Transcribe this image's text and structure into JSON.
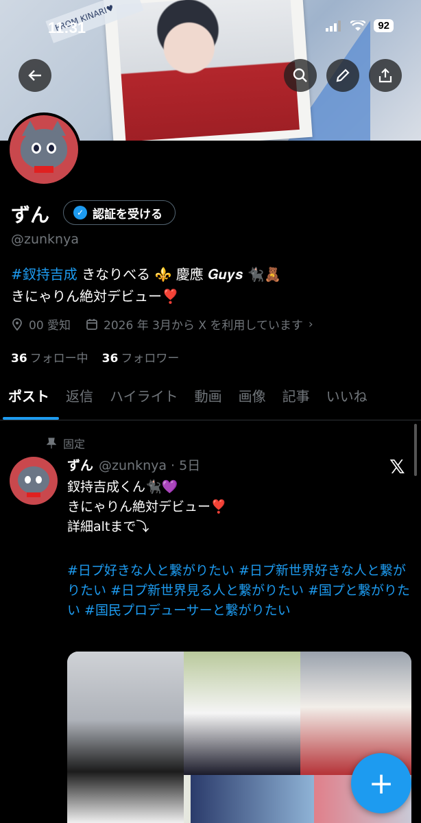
{
  "status_bar": {
    "time": "11:31",
    "battery": "92"
  },
  "banner": {
    "tape_text": "FROM KINARI♥"
  },
  "profile": {
    "name": "ずん",
    "verify_label": "認証を受ける",
    "handle": "@zunknya",
    "bio_hashtag": "#釵持吉成",
    "bio_line1_rest": " きなりべる ⚜️ 慶應 𝑮𝒖𝒚𝒔 🐈‍⬛🧸",
    "bio_line2": "きにゃりん絶対デビュー❣️",
    "location": "00 愛知",
    "joined": "2026 年 3月から X を利用しています",
    "following_count": "36",
    "following_label": "フォロー中",
    "followers_count": "36",
    "followers_label": "フォロワー"
  },
  "tabs": [
    "ポスト",
    "返信",
    "ハイライト",
    "動画",
    "画像",
    "記事",
    "いいね"
  ],
  "post": {
    "pinned_label": "固定",
    "author": "ずん",
    "handle_time": "@zunknya · 5日",
    "line1": "釵持吉成くん🐈‍⬛💜",
    "line2": "きにゃりん絶対デビュー❣️",
    "line3": "詳細altまで⤵︎",
    "hashtags": "#日プ好きな人と繋がりたい #日プ新世界好きな人と繋がりたい #日プ新世界見る人と繋がりたい #国プと繋がりたい #国民プロデューサーと繋がりたい"
  },
  "colors": {
    "accent": "#1d9bf0",
    "background": "#000000",
    "muted": "#71767b"
  }
}
